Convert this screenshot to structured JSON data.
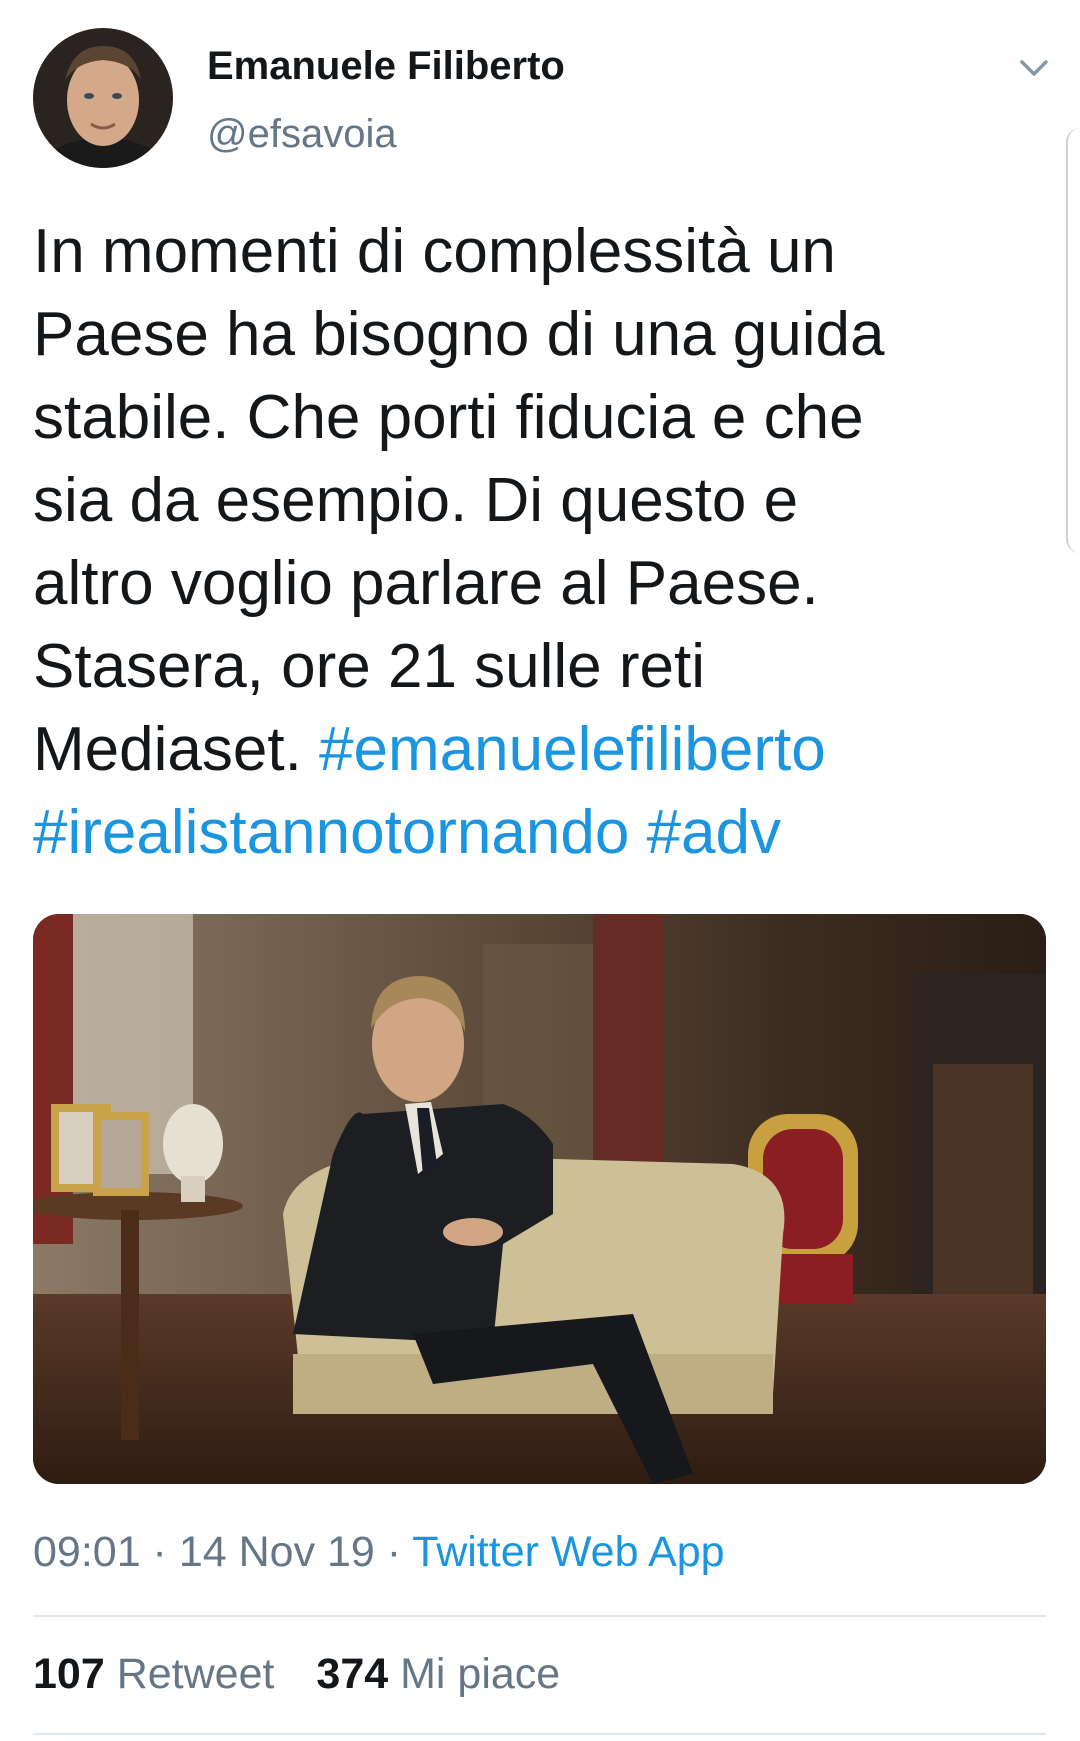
{
  "tweet": {
    "author": {
      "name": "Emanuele Filiberto",
      "handle": "@efsavoia"
    },
    "text": {
      "line1": "In momenti di complessità un",
      "line2": "Paese ha bisogno di una guida",
      "line3": "stabile. Che porti fiducia e che",
      "line4": "sia da esempio. Di questo e",
      "line5": "altro voglio parlare al Paese.",
      "line6": "Stasera, ore 21 sulle reti",
      "line7_plain": "Mediaset. ",
      "hashtag1": "#emanuelefiliberto",
      "hashtag2": "#irealistannotornando",
      "hashtag3": "#adv"
    },
    "meta": {
      "time": "09:01",
      "separator": " · ",
      "date": "14 Nov 19",
      "source": "Twitter Web App"
    },
    "stats": {
      "retweet_count": "107",
      "retweet_label": "Retweet",
      "like_count": "374",
      "like_label": "Mi piace"
    }
  },
  "icons": {
    "menu": "chevron-down-icon"
  },
  "colors": {
    "link": "#1b95e0",
    "secondary_text": "#657786",
    "primary_text": "#14171a",
    "divider": "#e1e8ed"
  }
}
